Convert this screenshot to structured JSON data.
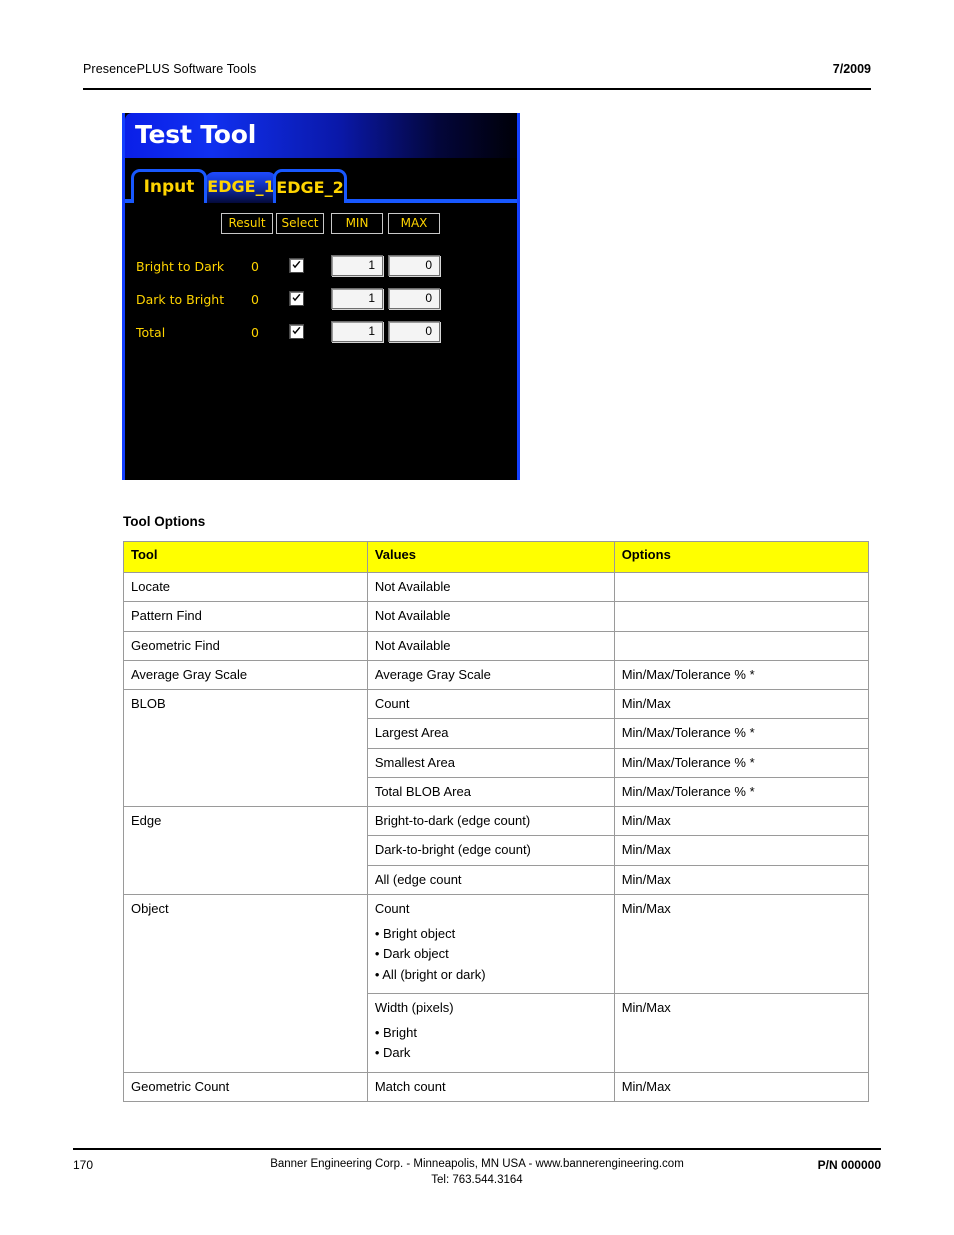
{
  "header": {
    "left": "PresencePLUS Software Tools",
    "right": "7/2009"
  },
  "screenshot_panel": {
    "title": "Test Tool",
    "tabs": [
      {
        "label": "Input",
        "state": "selected"
      },
      {
        "label": "EDGE_1",
        "state": "active"
      },
      {
        "label": "EDGE_2",
        "state": "normal"
      }
    ],
    "column_headers": {
      "result": "Result",
      "select": "Select",
      "min": "MIN",
      "max": "MAX"
    },
    "rows": [
      {
        "label": "Bright to Dark",
        "result": "0",
        "select": true,
        "min": "1",
        "max": "0"
      },
      {
        "label": "Dark to Bright",
        "result": "0",
        "select": true,
        "min": "1",
        "max": "0"
      },
      {
        "label": "Total",
        "result": "0",
        "select": true,
        "min": "1",
        "max": "0"
      }
    ],
    "colors": {
      "text": "#ffd400",
      "border": "#1858ff",
      "background": "#000000"
    }
  },
  "tool_options": {
    "section_title": "Tool Options",
    "header_color": "#ffff00",
    "columns": [
      "Tool",
      "Values",
      "Options"
    ],
    "rows": [
      {
        "tool": "Locate",
        "values": "Not Available",
        "options": ""
      },
      {
        "tool": "Pattern Find",
        "values": "Not Available",
        "options": ""
      },
      {
        "tool": "Geometric Find",
        "values": "Not Available",
        "options": ""
      },
      {
        "tool": "Average Gray Scale",
        "values": "Average Gray Scale",
        "options": "Min/Max/Tolerance % *"
      },
      {
        "tool": "BLOB",
        "values": "Count",
        "options": "Min/Max"
      },
      {
        "tool": "",
        "values": "Largest Area",
        "options": "Min/Max/Tolerance % *"
      },
      {
        "tool": "",
        "values": "Smallest Area",
        "options": "Min/Max/Tolerance % *"
      },
      {
        "tool": "",
        "values": "Total BLOB Area",
        "options": "Min/Max/Tolerance % *"
      },
      {
        "tool": "Edge",
        "values": "Bright-to-dark (edge count)",
        "options": "Min/Max"
      },
      {
        "tool": "",
        "values": "Dark-to-bright (edge count)",
        "options": "Min/Max"
      },
      {
        "tool": "",
        "values": "All (edge count",
        "options": "Min/Max"
      },
      {
        "tool": "Object",
        "values": "Count",
        "values_bullets": [
          "• Bright object",
          "• Dark object",
          "• All (bright or dark)"
        ],
        "options": "Min/Max"
      },
      {
        "tool": "",
        "values": "Width (pixels)",
        "values_bullets": [
          "• Bright",
          "• Dark"
        ],
        "options": "Min/Max"
      },
      {
        "tool": "Geometric Count",
        "values": "Match count",
        "options": "Min/Max"
      }
    ]
  },
  "footer": {
    "page_number": "170",
    "center_line1": "Banner Engineering Corp. - Minneapolis, MN USA - www.bannerengineering.com",
    "center_line2": "Tel: 763.544.3164",
    "part_number": "P/N 000000"
  }
}
